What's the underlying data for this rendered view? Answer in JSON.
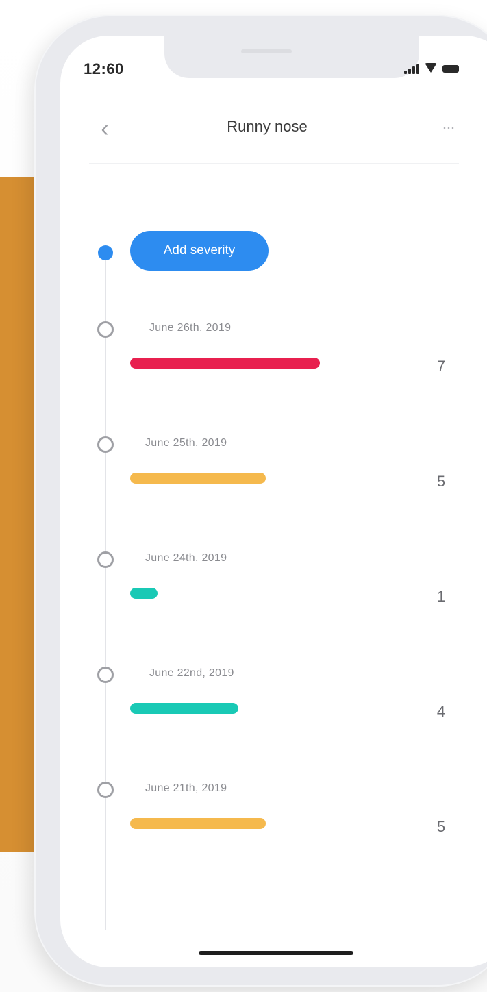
{
  "status_bar": {
    "time": "12:60"
  },
  "nav": {
    "back_glyph": "‹",
    "title": "Runny nose",
    "more_glyph": "···"
  },
  "add_button": {
    "label": "Add severity",
    "color": "#2d8cf0"
  },
  "entries": [
    {
      "date": "June 26th, 2019",
      "value": "7",
      "severity_fraction": 0.7,
      "color": "#e8204f"
    },
    {
      "date": "June 25th, 2019",
      "value": "5",
      "severity_fraction": 0.5,
      "color": "#f5b94d"
    },
    {
      "date": "June 24th, 2019",
      "value": "1",
      "severity_fraction": 0.1,
      "color": "#19c9b5"
    },
    {
      "date": "June 22nd, 2019",
      "value": "4",
      "severity_fraction": 0.4,
      "color": "#19c9b5"
    },
    {
      "date": "June 21th, 2019",
      "value": "5",
      "severity_fraction": 0.5,
      "color": "#f5b94d"
    }
  ],
  "icons": {
    "back": "chevron-left-icon",
    "more": "more-horizontal-icon",
    "signal": "cellular-signal-icon",
    "wifi": "wifi-icon",
    "battery": "battery-icon"
  },
  "colors": {
    "accent": "#2d8cf0",
    "backdrop": "#d68f32"
  }
}
